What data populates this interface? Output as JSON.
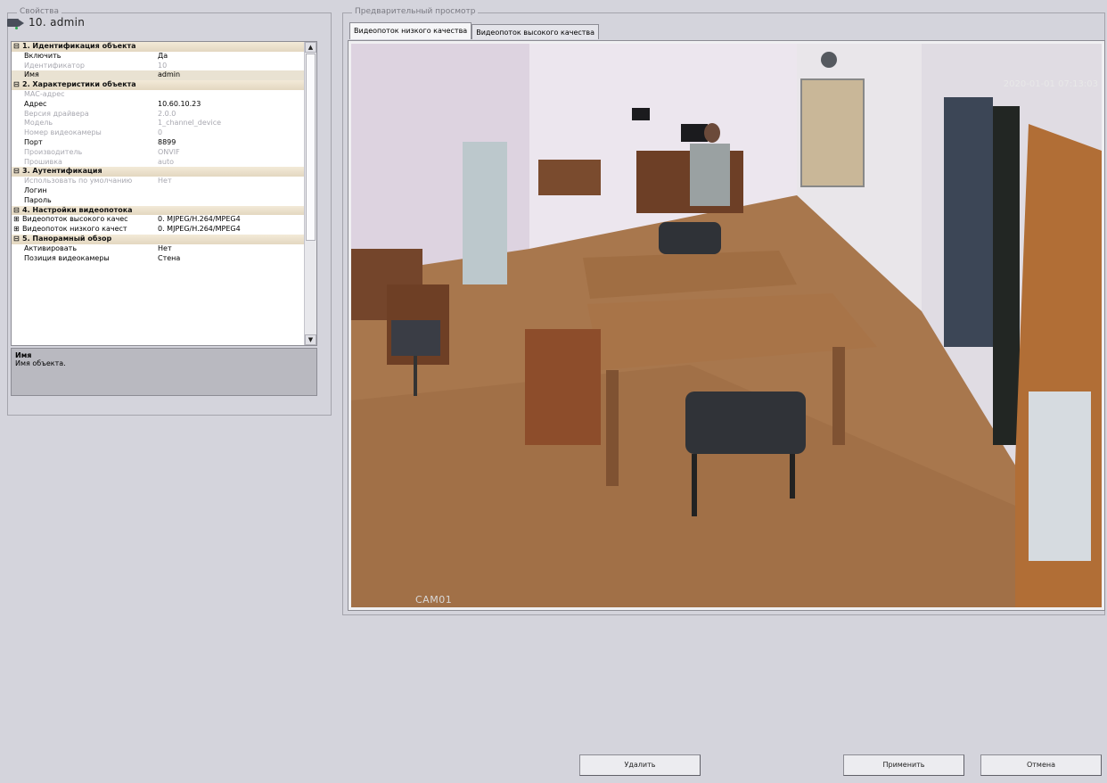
{
  "properties": {
    "caption": "Свойства",
    "object_title": "10. admin",
    "rows": [
      {
        "type": "cat",
        "toggle": "⊟",
        "name": "1. Идентификация объекта"
      },
      {
        "type": "prop",
        "name": "Включить",
        "value": "Да",
        "disabled": false
      },
      {
        "type": "prop",
        "name": "Идентификатор",
        "value": "10",
        "disabled": true
      },
      {
        "type": "prop",
        "name": "Имя",
        "value": "admin",
        "disabled": false,
        "selected": true
      },
      {
        "type": "cat",
        "toggle": "⊟",
        "name": "2. Характеристики объекта"
      },
      {
        "type": "prop",
        "name": "MAC-адрес",
        "value": "",
        "disabled": true
      },
      {
        "type": "prop",
        "name": "Адрес",
        "value": "10.60.10.23",
        "disabled": false
      },
      {
        "type": "prop",
        "name": "Версия драйвера",
        "value": "2.0.0",
        "disabled": true
      },
      {
        "type": "prop",
        "name": "Модель",
        "value": "1_channel_device",
        "disabled": true
      },
      {
        "type": "prop",
        "name": "Номер видеокамеры",
        "value": "0",
        "disabled": true
      },
      {
        "type": "prop",
        "name": "Порт",
        "value": "8899",
        "disabled": false
      },
      {
        "type": "prop",
        "name": "Производитель",
        "value": "ONVIF",
        "disabled": true
      },
      {
        "type": "prop",
        "name": "Прошивка",
        "value": "auto",
        "disabled": true
      },
      {
        "type": "cat",
        "toggle": "⊟",
        "name": "3. Аутентификация"
      },
      {
        "type": "prop",
        "name": "Использовать по умолчанию",
        "value": "Нет",
        "disabled": true
      },
      {
        "type": "prop",
        "name": "Логин",
        "value": "",
        "disabled": false
      },
      {
        "type": "prop",
        "name": "Пароль",
        "value": "",
        "disabled": false
      },
      {
        "type": "cat",
        "toggle": "⊟",
        "name": "4. Настройки видеопотока"
      },
      {
        "type": "sub",
        "toggle": "⊞",
        "name": "Видеопоток высокого качес",
        "value": "0. MJPEG/H.264/MPEG4"
      },
      {
        "type": "sub",
        "toggle": "⊞",
        "name": "Видеопоток низкого качест",
        "value": "0. MJPEG/H.264/MPEG4"
      },
      {
        "type": "cat",
        "toggle": "⊟",
        "name": "5. Панорамный обзор"
      },
      {
        "type": "prop",
        "name": "Активировать",
        "value": "Нет",
        "disabled": false
      },
      {
        "type": "prop",
        "name": "Позиция видеокамеры",
        "value": "Стена",
        "disabled": false
      }
    ],
    "description": {
      "title": "Имя",
      "text": "Имя объекта."
    }
  },
  "preview": {
    "caption": "Предварительный просмотр",
    "tabs": [
      "Видеопоток низкого качества",
      "Видеопоток высокого качества"
    ],
    "active_tab": 0,
    "camera_label": "CAM01",
    "timestamp": "2020-01-01 07:13:03"
  },
  "buttons": {
    "delete": "Удалить",
    "apply": "Применить",
    "cancel": "Отмена"
  }
}
